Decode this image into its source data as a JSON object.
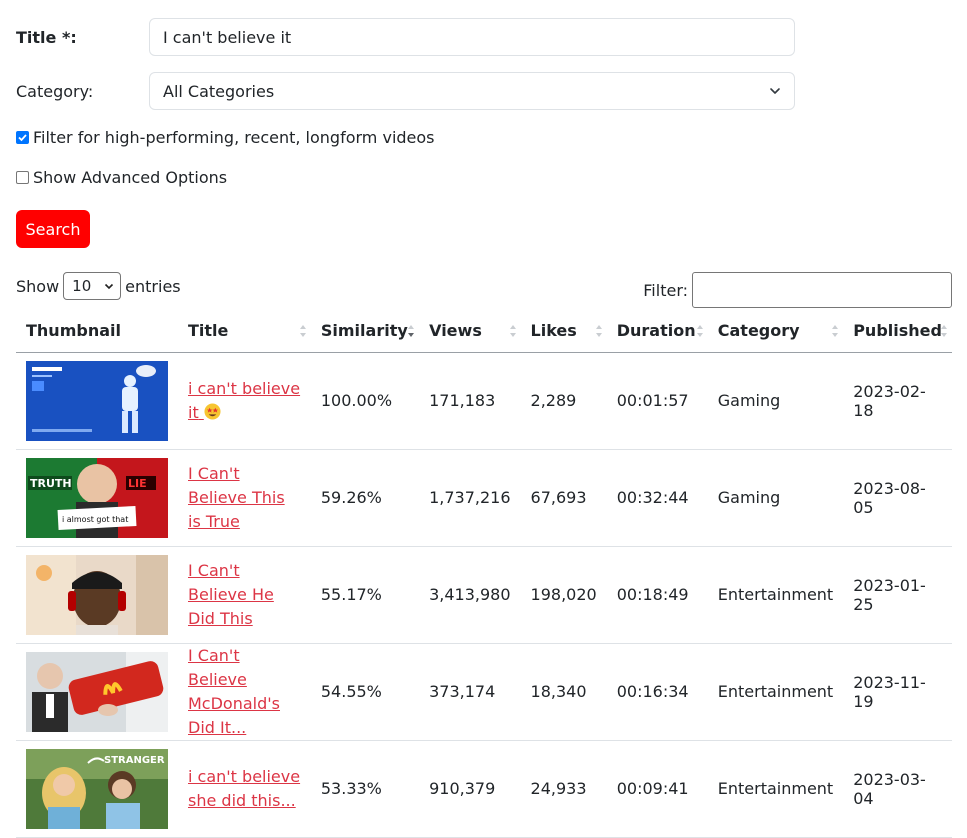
{
  "form": {
    "title_label": "Title *:",
    "title_value": "I can't believe it",
    "category_label": "Category:",
    "category_value": "All Categories",
    "filter_checkbox_label": "Filter for high-performing, recent, longform videos",
    "filter_checked": true,
    "advanced_checkbox_label": "Show Advanced Options",
    "advanced_checked": false,
    "search_button": "Search"
  },
  "table_controls": {
    "show_label": "Show",
    "entries_value": "10",
    "entries_label": "entries",
    "filter_label": "Filter:"
  },
  "colors": {
    "accent": "#ff0000",
    "link": "#dc3545",
    "checkbox": "#0075ff"
  },
  "columns": [
    "Thumbnail",
    "Title",
    "Similarity",
    "Views",
    "Likes",
    "Duration",
    "Category",
    "Published"
  ],
  "rows": [
    {
      "title": "i can't believe it",
      "title_emoji": "star-struck-emoji",
      "similarity": "100.00%",
      "views": "171,183",
      "likes": "2,289",
      "duration": "00:01:57",
      "category": "Gaming",
      "published": "2023-02-18"
    },
    {
      "title": "I Can't Believe This is True",
      "similarity": "59.26%",
      "views": "1,737,216",
      "likes": "67,693",
      "duration": "00:32:44",
      "category": "Gaming",
      "published": "2023-08-05",
      "thumb_text": [
        "TRUTH",
        "LIE",
        "i almost got that"
      ]
    },
    {
      "title": "I Can't Believe He Did This",
      "similarity": "55.17%",
      "views": "3,413,980",
      "likes": "198,020",
      "duration": "00:18:49",
      "category": "Entertainment",
      "published": "2023-01-25"
    },
    {
      "title": "I Can't Believe McDonald's Did It...",
      "similarity": "54.55%",
      "views": "373,174",
      "likes": "18,340",
      "duration": "00:16:34",
      "category": "Entertainment",
      "published": "2023-11-19"
    },
    {
      "title": "i can't believe she did this...",
      "similarity": "53.33%",
      "views": "910,379",
      "likes": "24,933",
      "duration": "00:09:41",
      "category": "Entertainment",
      "published": "2023-03-04",
      "thumb_text": [
        "STRANGER"
      ]
    }
  ]
}
